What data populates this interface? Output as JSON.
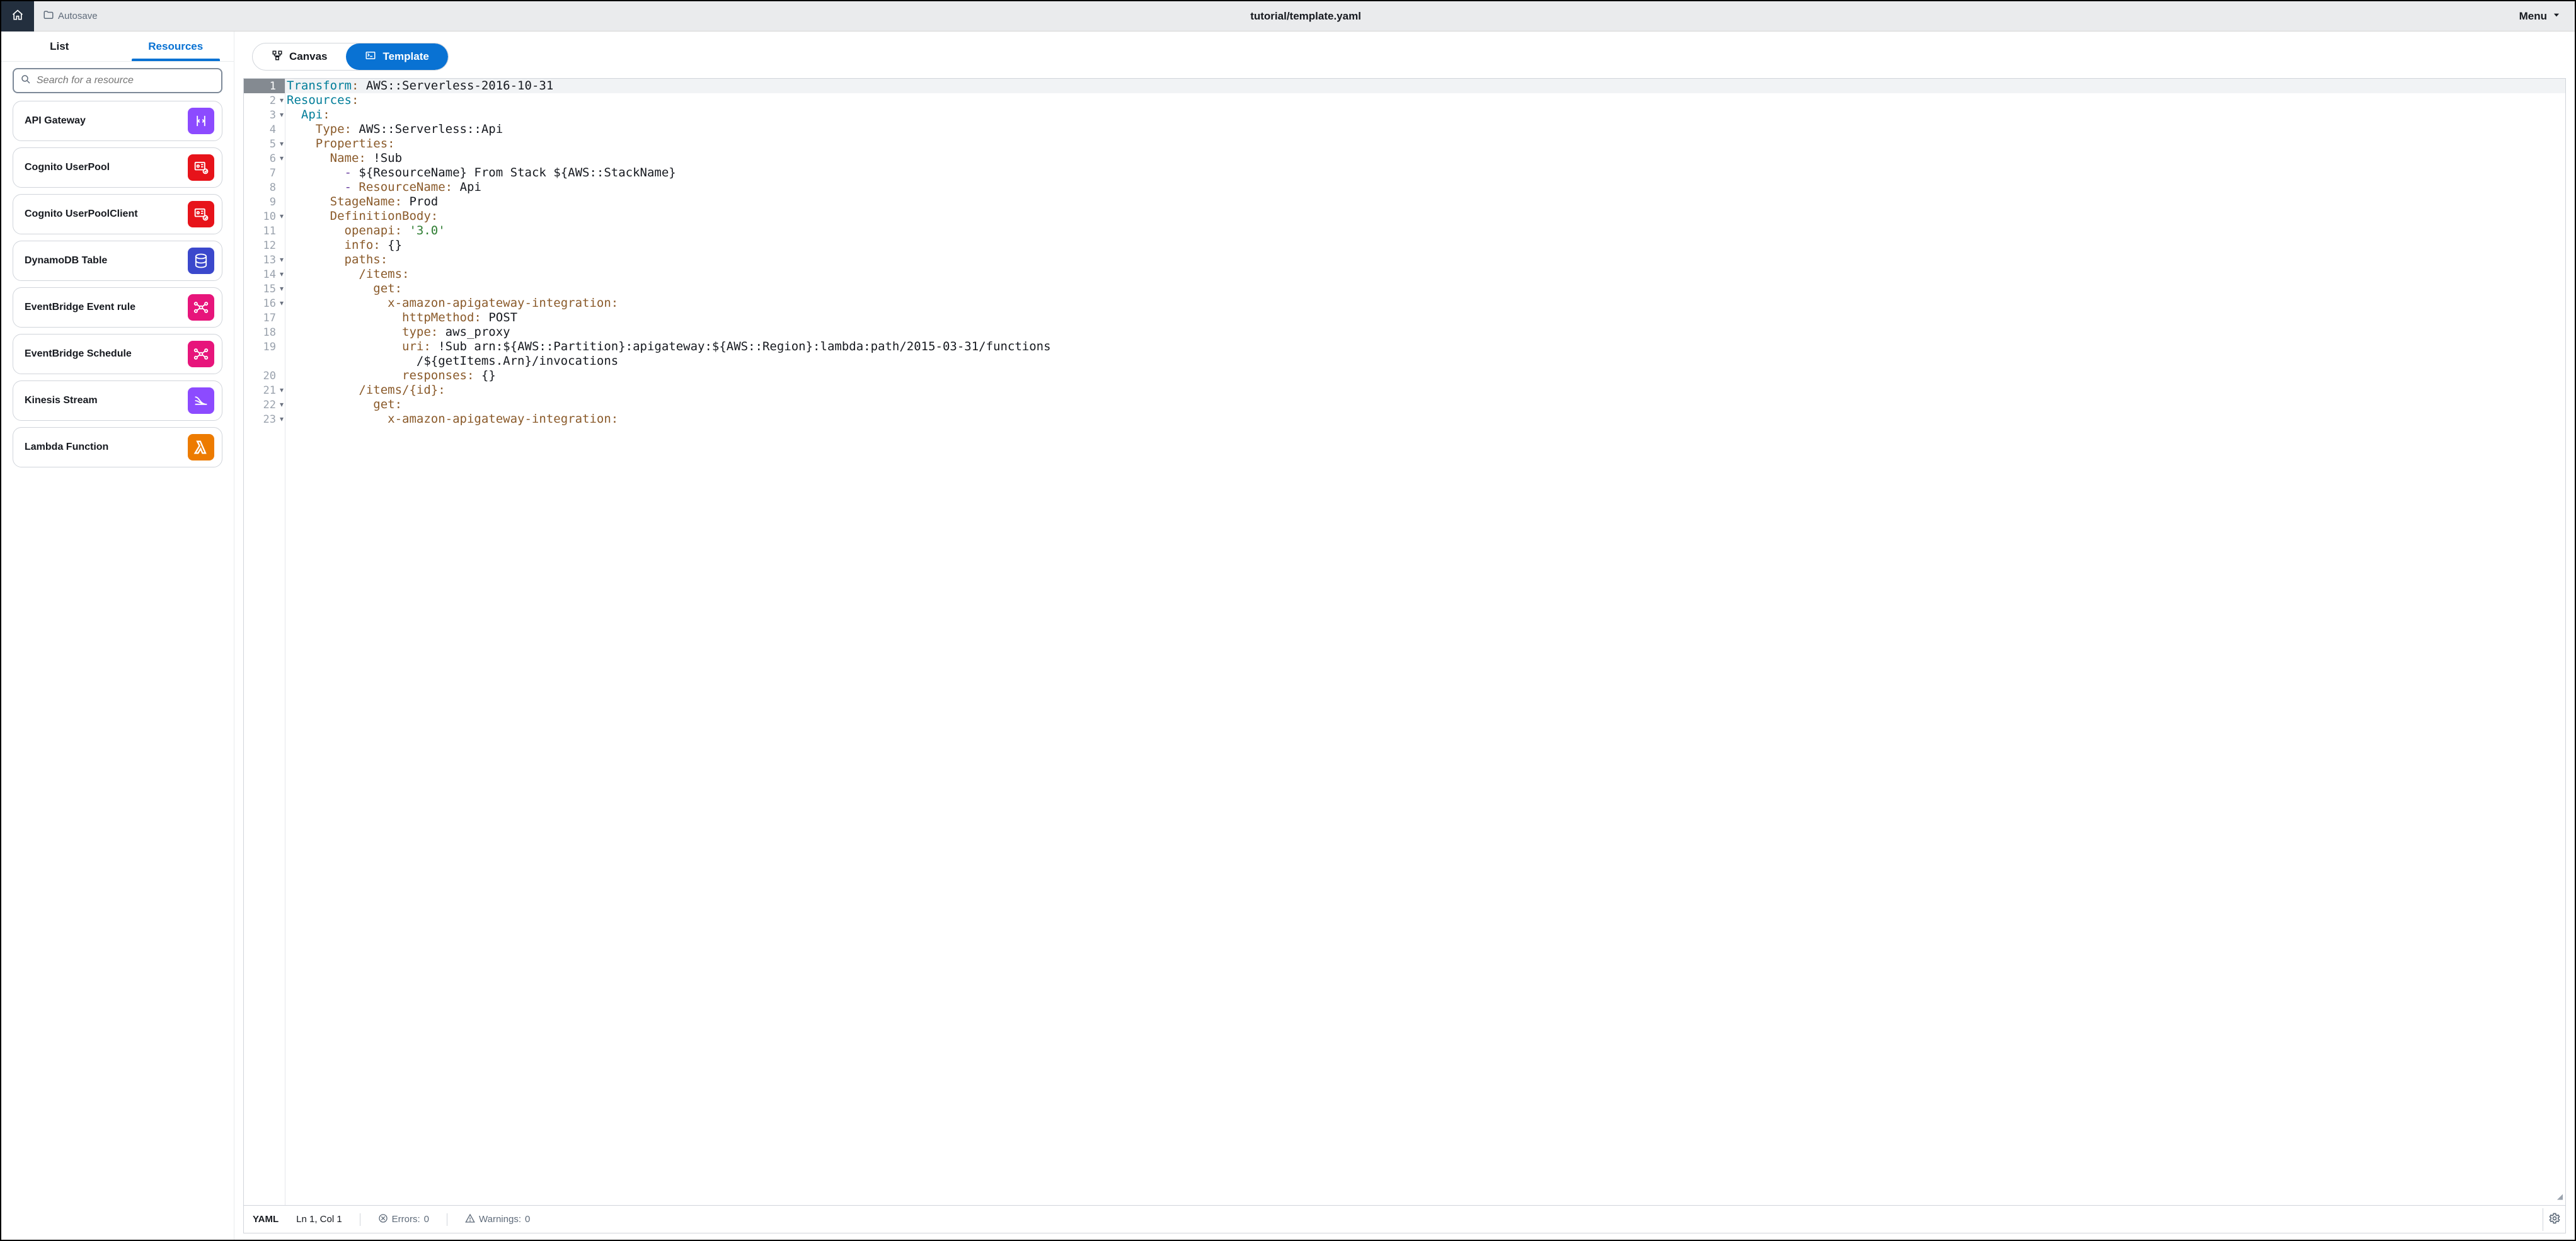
{
  "topbar": {
    "autosave_label": "Autosave",
    "title": "tutorial/template.yaml",
    "menu_label": "Menu"
  },
  "sidebar": {
    "tabs": {
      "list": "List",
      "resources": "Resources"
    },
    "active_tab": "resources",
    "search_placeholder": "Search for a resource",
    "items": [
      {
        "label": "API Gateway",
        "icon": "apigateway",
        "color": "purple"
      },
      {
        "label": "Cognito UserPool",
        "icon": "cognito",
        "color": "red"
      },
      {
        "label": "Cognito UserPoolClient",
        "icon": "cognito",
        "color": "red"
      },
      {
        "label": "DynamoDB Table",
        "icon": "dynamodb",
        "color": "blue"
      },
      {
        "label": "EventBridge Event rule",
        "icon": "eventbridge",
        "color": "pink"
      },
      {
        "label": "EventBridge Schedule",
        "icon": "eventbridge",
        "color": "pink"
      },
      {
        "label": "Kinesis Stream",
        "icon": "kinesis",
        "color": "purple"
      },
      {
        "label": "Lambda Function",
        "icon": "lambda",
        "color": "orange"
      }
    ]
  },
  "view_toggle": {
    "canvas": "Canvas",
    "template": "Template",
    "active": "template"
  },
  "editor": {
    "current_line": 1,
    "lines": [
      {
        "n": 1,
        "fold": false,
        "segments": [
          {
            "c": "tok-id",
            "t": "Transform"
          },
          {
            "c": "tok-key",
            "t": ": "
          },
          {
            "c": "tok-plain",
            "t": "AWS::Serverless-2016-10-31"
          }
        ]
      },
      {
        "n": 2,
        "fold": true,
        "segments": [
          {
            "c": "tok-id",
            "t": "Resources"
          },
          {
            "c": "tok-key",
            "t": ":"
          }
        ]
      },
      {
        "n": 3,
        "fold": true,
        "segments": [
          {
            "c": "tok-plain",
            "t": "  "
          },
          {
            "c": "tok-id",
            "t": "Api"
          },
          {
            "c": "tok-key",
            "t": ":"
          }
        ]
      },
      {
        "n": 4,
        "fold": false,
        "segments": [
          {
            "c": "tok-plain",
            "t": "    "
          },
          {
            "c": "tok-key",
            "t": "Type: "
          },
          {
            "c": "tok-plain",
            "t": "AWS::Serverless::Api"
          }
        ]
      },
      {
        "n": 5,
        "fold": true,
        "segments": [
          {
            "c": "tok-plain",
            "t": "    "
          },
          {
            "c": "tok-key",
            "t": "Properties:"
          }
        ]
      },
      {
        "n": 6,
        "fold": true,
        "segments": [
          {
            "c": "tok-plain",
            "t": "      "
          },
          {
            "c": "tok-key",
            "t": "Name: "
          },
          {
            "c": "tok-plain",
            "t": "!Sub"
          }
        ]
      },
      {
        "n": 7,
        "fold": false,
        "segments": [
          {
            "c": "tok-plain",
            "t": "        "
          },
          {
            "c": "tok-alt",
            "t": "- "
          },
          {
            "c": "tok-plain",
            "t": "${ResourceName} From Stack ${AWS::StackName}"
          }
        ]
      },
      {
        "n": 8,
        "fold": false,
        "segments": [
          {
            "c": "tok-plain",
            "t": "        "
          },
          {
            "c": "tok-alt",
            "t": "- "
          },
          {
            "c": "tok-key",
            "t": "ResourceName: "
          },
          {
            "c": "tok-plain",
            "t": "Api"
          }
        ]
      },
      {
        "n": 9,
        "fold": false,
        "segments": [
          {
            "c": "tok-plain",
            "t": "      "
          },
          {
            "c": "tok-key",
            "t": "StageName: "
          },
          {
            "c": "tok-plain",
            "t": "Prod"
          }
        ]
      },
      {
        "n": 10,
        "fold": true,
        "segments": [
          {
            "c": "tok-plain",
            "t": "      "
          },
          {
            "c": "tok-key",
            "t": "DefinitionBody:"
          }
        ]
      },
      {
        "n": 11,
        "fold": false,
        "segments": [
          {
            "c": "tok-plain",
            "t": "        "
          },
          {
            "c": "tok-key",
            "t": "openapi: "
          },
          {
            "c": "tok-str",
            "t": "'3.0'"
          }
        ]
      },
      {
        "n": 12,
        "fold": false,
        "segments": [
          {
            "c": "tok-plain",
            "t": "        "
          },
          {
            "c": "tok-key",
            "t": "info: "
          },
          {
            "c": "tok-plain",
            "t": "{}"
          }
        ]
      },
      {
        "n": 13,
        "fold": true,
        "segments": [
          {
            "c": "tok-plain",
            "t": "        "
          },
          {
            "c": "tok-key",
            "t": "paths:"
          }
        ]
      },
      {
        "n": 14,
        "fold": true,
        "segments": [
          {
            "c": "tok-plain",
            "t": "          "
          },
          {
            "c": "tok-key",
            "t": "/items:"
          }
        ]
      },
      {
        "n": 15,
        "fold": true,
        "segments": [
          {
            "c": "tok-plain",
            "t": "            "
          },
          {
            "c": "tok-key",
            "t": "get:"
          }
        ]
      },
      {
        "n": 16,
        "fold": true,
        "segments": [
          {
            "c": "tok-plain",
            "t": "              "
          },
          {
            "c": "tok-key",
            "t": "x-amazon-apigateway-integration:"
          }
        ]
      },
      {
        "n": 17,
        "fold": false,
        "segments": [
          {
            "c": "tok-plain",
            "t": "                "
          },
          {
            "c": "tok-key",
            "t": "httpMethod: "
          },
          {
            "c": "tok-plain",
            "t": "POST"
          }
        ]
      },
      {
        "n": 18,
        "fold": false,
        "segments": [
          {
            "c": "tok-plain",
            "t": "                "
          },
          {
            "c": "tok-key",
            "t": "type: "
          },
          {
            "c": "tok-plain",
            "t": "aws_proxy"
          }
        ]
      },
      {
        "n": 19,
        "fold": false,
        "segments": [
          {
            "c": "tok-plain",
            "t": "                "
          },
          {
            "c": "tok-key",
            "t": "uri: "
          },
          {
            "c": "tok-plain",
            "t": "!Sub arn:${AWS::Partition}:apigateway:${AWS::Region}:lambda:path/2015-03-31/functions"
          }
        ]
      },
      {
        "n": null,
        "fold": false,
        "segments": [
          {
            "c": "tok-plain",
            "t": "                  /${getItems.Arn}/invocations"
          }
        ]
      },
      {
        "n": 20,
        "fold": false,
        "segments": [
          {
            "c": "tok-plain",
            "t": "                "
          },
          {
            "c": "tok-key",
            "t": "responses: "
          },
          {
            "c": "tok-plain",
            "t": "{}"
          }
        ]
      },
      {
        "n": 21,
        "fold": true,
        "segments": [
          {
            "c": "tok-plain",
            "t": "          "
          },
          {
            "c": "tok-key",
            "t": "/items/{id}:"
          }
        ]
      },
      {
        "n": 22,
        "fold": true,
        "segments": [
          {
            "c": "tok-plain",
            "t": "            "
          },
          {
            "c": "tok-key",
            "t": "get:"
          }
        ]
      },
      {
        "n": 23,
        "fold": true,
        "segments": [
          {
            "c": "tok-plain",
            "t": "              "
          },
          {
            "c": "tok-key",
            "t": "x-amazon-apigateway-integration:"
          }
        ]
      }
    ]
  },
  "status": {
    "language": "YAML",
    "position": "Ln 1, Col 1",
    "errors_label": "Errors:",
    "errors_count": "0",
    "warnings_label": "Warnings:",
    "warnings_count": "0"
  }
}
